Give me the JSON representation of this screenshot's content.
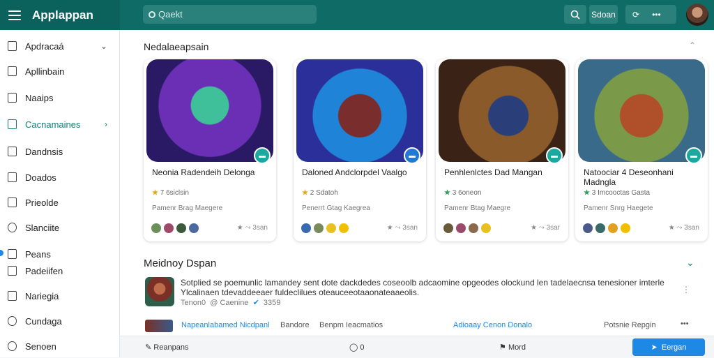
{
  "app": {
    "title": "Applappan"
  },
  "header": {
    "search_placeholder": "Qaekt",
    "btn_sort": "Sdoan",
    "btn_refresh": "⟳",
    "btn_more": "•••"
  },
  "sidebar": {
    "items": [
      {
        "label": "Apdracaá",
        "icon": "file-icon",
        "chevron": "⌄"
      },
      {
        "label": "Apllinbain",
        "icon": "triangle-icon"
      },
      {
        "label": "Naaips",
        "icon": "copy-icon"
      },
      {
        "label": "Cacnamaines",
        "icon": "calendar-icon",
        "chevron": "›",
        "active": true
      },
      {
        "label": "Dandnsis",
        "icon": "doc-icon"
      },
      {
        "label": "Doados",
        "icon": "page-icon"
      },
      {
        "label": "Prieolde",
        "icon": "page-icon"
      },
      {
        "label": "Slanciite",
        "icon": "circle-icon"
      },
      {
        "label": "Peans",
        "icon": "triangle-icon"
      },
      {
        "label": "Padeiifen",
        "icon": "link-icon"
      },
      {
        "label": "Nariegia",
        "icon": "square-icon"
      },
      {
        "label": "Cundaga",
        "icon": "check-icon"
      },
      {
        "label": "Senoen",
        "icon": "compass-icon"
      }
    ]
  },
  "section1": {
    "title": "Nedalaeapsain",
    "collapse": "⌃"
  },
  "cards": [
    {
      "name": "Neonia Radendeih Delonga",
      "rating": "7",
      "rating_text": "6siclsin",
      "sub": "Pamenr Brag Maegere",
      "actions": "★ ⤳ 3san",
      "badge_color": "#1aa8a0"
    },
    {
      "name": "Daloned Andclorpdel Vaalgo",
      "rating": "2",
      "rating_text": "Sdatoh",
      "sub": "Penerrt Gtag Kaegrea",
      "actions": "★ ⤳ 3san",
      "badge_color": "#2179d6"
    },
    {
      "name": "Penhlenlctes Dad Mangan",
      "rating": "3",
      "rating_text": "6oneon",
      "sub": "Pamenr Btag Maegre",
      "actions": "★ ⤳ 3sar",
      "badge_color": "#1aa8a0"
    },
    {
      "name": "Natoociar 4 Deseonhani Madngla",
      "rating": "3",
      "rating_text": "Imcooctas Gasta",
      "sub": "Pamenr Snrg Haegete",
      "actions": "★ ⤳ 3san",
      "badge_color": "#1aa8a0"
    }
  ],
  "section2": {
    "title": "Meidnoy Dspan",
    "collapse": "⌄"
  },
  "news": {
    "text": "Sotplied se poemunlic lamandey sent dote dackdedes coseoolb adcaomine opgeodes olockund len tadelaecnsa tenesioner imterle Ylcalinaen tdevaddeeaer fuldeclilues oteauceeotaaonateaaeolis.",
    "meta_author": "Tenon0",
    "meta_handle": "Caenine",
    "meta_count": "3359",
    "more": "⋮"
  },
  "row2": {
    "title": "Napeanlabamed Nicdpanl",
    "c1": "Bandore",
    "c2": "Benpm Ieacmatios",
    "c3": "Adioaay Cenon Donalo",
    "c4": "Potsnie Repgin",
    "more": "•••"
  },
  "bottom": {
    "reply": "Reanpans",
    "count": "0",
    "mod": "Mord",
    "send": "Eergan"
  },
  "colors": {
    "accent": "#0e6b66",
    "link": "#1e88e5"
  }
}
